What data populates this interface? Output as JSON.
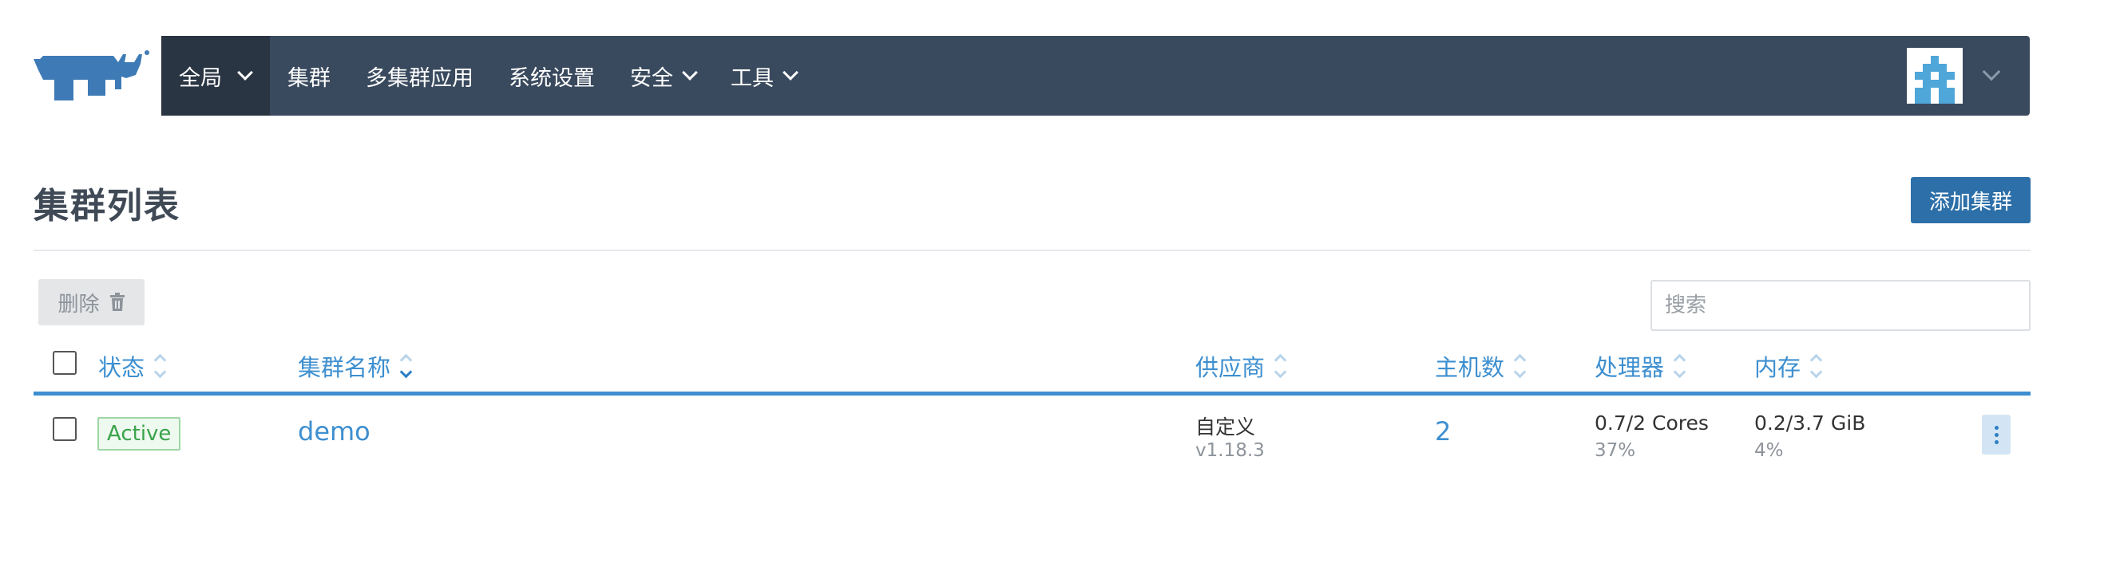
{
  "header": {
    "nav": [
      {
        "label": "全局",
        "has_dropdown": true,
        "active": true
      },
      {
        "label": "集群",
        "has_dropdown": false
      },
      {
        "label": "多集群应用",
        "has_dropdown": false
      },
      {
        "label": "系统设置",
        "has_dropdown": false
      },
      {
        "label": "安全",
        "has_dropdown": true
      },
      {
        "label": "工具",
        "has_dropdown": true
      }
    ],
    "logo_icon": "cow-icon",
    "avatar_icon": "identicon"
  },
  "page": {
    "title": "集群列表",
    "add_button": "添加集群",
    "delete_button": "删除",
    "search_placeholder": "搜索"
  },
  "table": {
    "columns": {
      "state": "状态",
      "name": "集群名称",
      "provider": "供应商",
      "nodes": "主机数",
      "cpu": "处理器",
      "memory": "内存"
    },
    "rows": [
      {
        "state": "Active",
        "name": "demo",
        "provider": "自定义",
        "version": "v1.18.3",
        "nodes": "2",
        "cpu": "0.7/2 Cores",
        "cpu_pct": "37%",
        "memory": "0.2/3.7 GiB",
        "memory_pct": "4%"
      }
    ]
  },
  "colors": {
    "nav_bg": "#3a4a5e",
    "nav_active": "#2a3543",
    "accent": "#3d8fd0",
    "primary_button": "#2d6fa8",
    "active_badge": "#3aa34a"
  }
}
